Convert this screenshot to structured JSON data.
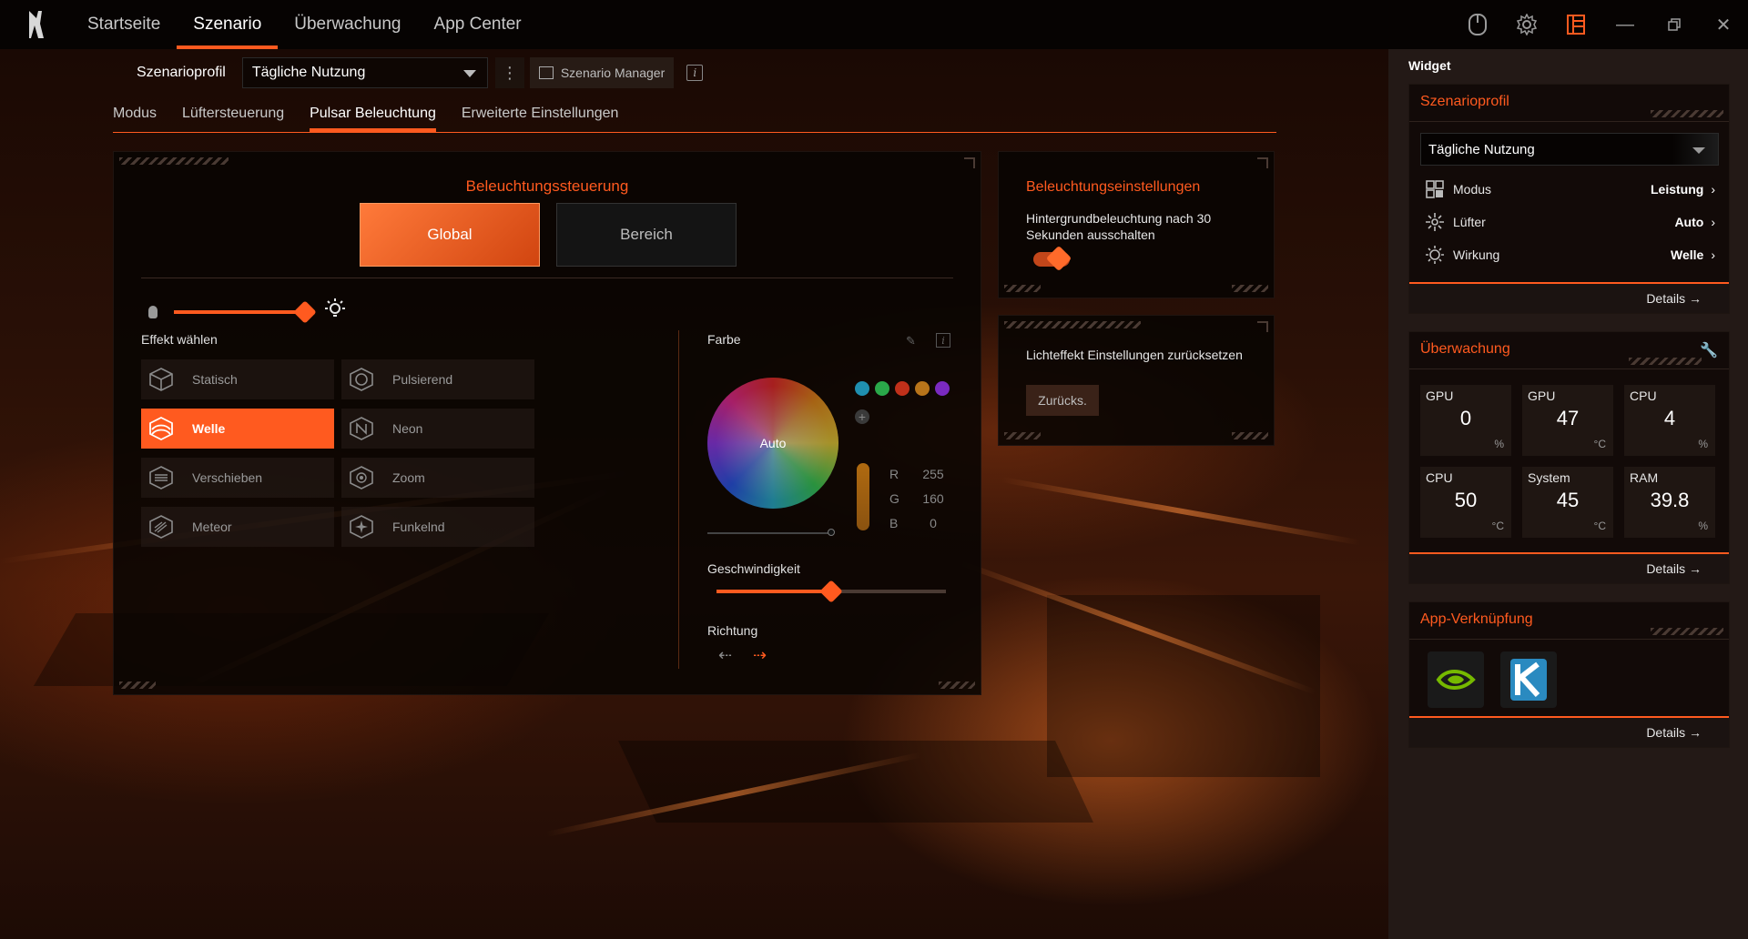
{
  "nav": {
    "items": [
      "Startseite",
      "Szenario",
      "Überwachung",
      "App Center"
    ],
    "active": 1
  },
  "profile": {
    "label": "Szenarioprofil",
    "selected": "Tägliche Nutzung",
    "manager_label": "Szenario Manager"
  },
  "subtabs": {
    "items": [
      "Modus",
      "Lüftersteuerung",
      "Pulsar Beleuchtung",
      "Erweiterte Einstellungen"
    ],
    "active": 2
  },
  "lighting": {
    "title": "Beleuchtungssteuerung",
    "segments": [
      "Global",
      "Bereich"
    ],
    "active_segment": "Global",
    "brightness_fraction": 1.0,
    "effect_label": "Effekt wählen",
    "effects": [
      "Statisch",
      "Pulsierend",
      "Welle",
      "Neon",
      "Verschieben",
      "Zoom",
      "Meteor",
      "Funkelnd"
    ],
    "active_effect": "Welle",
    "color_label": "Farbe",
    "wheel_label": "Auto",
    "preset_colors": [
      "#1f8fb0",
      "#2aa84a",
      "#c0301a",
      "#b8741a",
      "#7a2ac0"
    ],
    "add_symbol": "+",
    "rgb": [
      {
        "k": "R",
        "v": "255"
      },
      {
        "k": "G",
        "v": "160"
      },
      {
        "k": "B",
        "v": "0"
      }
    ],
    "speed_label": "Geschwindigkeit",
    "speed_fraction": 0.5,
    "direction_label": "Richtung",
    "direction_active": "right"
  },
  "settings": {
    "title": "Beleuchtungseinstellungen",
    "desc": "Hintergrundbeleuchtung nach 30 Sekunden ausschalten",
    "toggle_on": true
  },
  "reset": {
    "desc": "Lichteffekt Einstellungen zurücksetzen",
    "button": "Zurücks."
  },
  "widget": {
    "title": "Widget",
    "profile_card": {
      "title": "Szenarioprofil",
      "selected": "Tägliche Nutzung",
      "rows": [
        {
          "label": "Modus",
          "value": "Leistung",
          "icon": "grid-icon"
        },
        {
          "label": "Lüfter",
          "value": "Auto",
          "icon": "fan-icon"
        },
        {
          "label": "Wirkung",
          "value": "Welle",
          "icon": "sun-icon"
        }
      ],
      "details": "Details"
    },
    "monitor_card": {
      "title": "Überwachung",
      "metrics": [
        {
          "label": "GPU",
          "value": "0",
          "unit": "%"
        },
        {
          "label": "GPU",
          "value": "47",
          "unit": "°C"
        },
        {
          "label": "CPU",
          "value": "4",
          "unit": "%"
        },
        {
          "label": "CPU",
          "value": "50",
          "unit": "°C"
        },
        {
          "label": "System",
          "value": "45",
          "unit": "°C"
        },
        {
          "label": "RAM",
          "value": "39.8",
          "unit": "%"
        }
      ],
      "details": "Details"
    },
    "apps_card": {
      "title": "App-Verknüpfung",
      "apps": [
        "nvidia-icon",
        "k-app-icon"
      ],
      "details": "Details"
    }
  },
  "colors": {
    "accent": "#ff5a1f",
    "panel": "#080402",
    "sidebar": "#231916"
  }
}
